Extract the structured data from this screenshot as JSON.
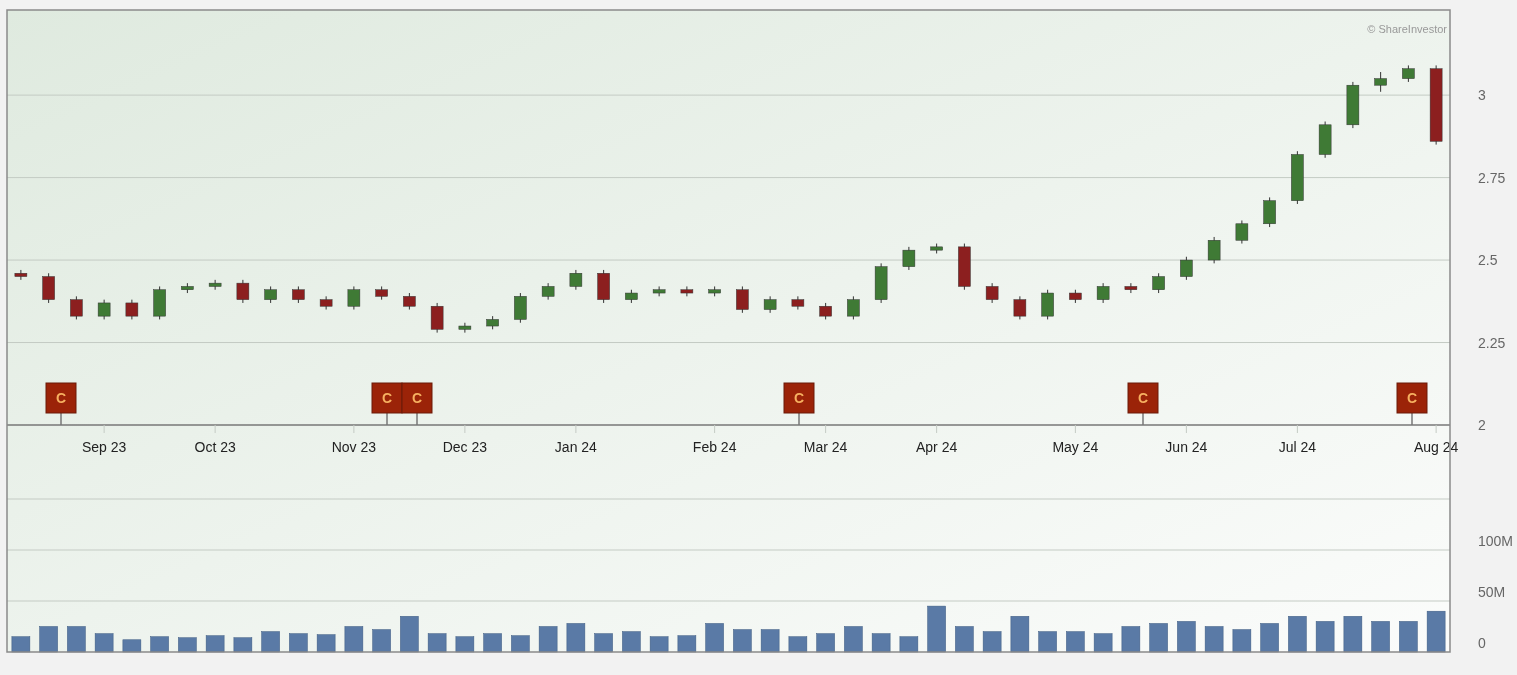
{
  "copyright": "© ShareInvestor",
  "price_chart": {
    "chart_data": {
      "type": "candlestick",
      "categories": [
        null,
        null,
        null,
        "Sep 23",
        null,
        null,
        null,
        "Oct 23",
        null,
        null,
        null,
        null,
        "Nov 23",
        null,
        null,
        null,
        "Dec 23",
        null,
        null,
        null,
        "Jan 24",
        null,
        null,
        null,
        null,
        "Feb 24",
        null,
        null,
        null,
        "Mar 24",
        null,
        null,
        null,
        "Apr 24",
        null,
        null,
        null,
        null,
        "May 24",
        null,
        null,
        null,
        "Jun 24",
        null,
        null,
        null,
        "Jul 24",
        null,
        null,
        null,
        null,
        "Aug 24"
      ],
      "ohlc": [
        [
          2.46,
          2.47,
          2.44,
          2.45
        ],
        [
          2.45,
          2.46,
          2.37,
          2.38
        ],
        [
          2.38,
          2.39,
          2.32,
          2.33
        ],
        [
          2.33,
          2.38,
          2.32,
          2.37
        ],
        [
          2.37,
          2.38,
          2.32,
          2.33
        ],
        [
          2.33,
          2.42,
          2.32,
          2.41
        ],
        [
          2.41,
          2.43,
          2.4,
          2.42
        ],
        [
          2.42,
          2.44,
          2.41,
          2.43
        ],
        [
          2.43,
          2.44,
          2.37,
          2.38
        ],
        [
          2.38,
          2.42,
          2.37,
          2.41
        ],
        [
          2.41,
          2.42,
          2.37,
          2.38
        ],
        [
          2.38,
          2.39,
          2.35,
          2.36
        ],
        [
          2.36,
          2.42,
          2.35,
          2.41
        ],
        [
          2.41,
          2.42,
          2.38,
          2.39
        ],
        [
          2.39,
          2.4,
          2.35,
          2.36
        ],
        [
          2.36,
          2.37,
          2.28,
          2.29
        ],
        [
          2.29,
          2.31,
          2.28,
          2.3
        ],
        [
          2.3,
          2.33,
          2.29,
          2.32
        ],
        [
          2.32,
          2.4,
          2.31,
          2.39
        ],
        [
          2.39,
          2.43,
          2.38,
          2.42
        ],
        [
          2.42,
          2.47,
          2.41,
          2.46
        ],
        [
          2.46,
          2.47,
          2.37,
          2.38
        ],
        [
          2.38,
          2.41,
          2.37,
          2.4
        ],
        [
          2.4,
          2.42,
          2.39,
          2.41
        ],
        [
          2.41,
          2.42,
          2.39,
          2.4
        ],
        [
          2.4,
          2.42,
          2.39,
          2.41
        ],
        [
          2.41,
          2.42,
          2.34,
          2.35
        ],
        [
          2.35,
          2.39,
          2.34,
          2.38
        ],
        [
          2.38,
          2.39,
          2.35,
          2.36
        ],
        [
          2.36,
          2.37,
          2.32,
          2.33
        ],
        [
          2.33,
          2.39,
          2.32,
          2.38
        ],
        [
          2.38,
          2.49,
          2.37,
          2.48
        ],
        [
          2.48,
          2.54,
          2.47,
          2.53
        ],
        [
          2.53,
          2.55,
          2.52,
          2.54
        ],
        [
          2.54,
          2.55,
          2.41,
          2.42
        ],
        [
          2.42,
          2.43,
          2.37,
          2.38
        ],
        [
          2.38,
          2.39,
          2.32,
          2.33
        ],
        [
          2.33,
          2.41,
          2.32,
          2.4
        ],
        [
          2.4,
          2.41,
          2.37,
          2.38
        ],
        [
          2.38,
          2.43,
          2.37,
          2.42
        ],
        [
          2.42,
          2.43,
          2.4,
          2.41
        ],
        [
          2.41,
          2.46,
          2.4,
          2.45
        ],
        [
          2.45,
          2.51,
          2.44,
          2.5
        ],
        [
          2.5,
          2.57,
          2.49,
          2.56
        ],
        [
          2.56,
          2.62,
          2.55,
          2.61
        ],
        [
          2.61,
          2.69,
          2.6,
          2.68
        ],
        [
          2.68,
          2.83,
          2.67,
          2.82
        ],
        [
          2.82,
          2.92,
          2.81,
          2.91
        ],
        [
          2.91,
          3.04,
          2.9,
          3.03
        ],
        [
          3.03,
          3.07,
          3.01,
          3.05
        ],
        [
          3.05,
          3.09,
          3.04,
          3.08
        ],
        [
          3.08,
          3.09,
          2.85,
          2.86
        ]
      ],
      "ylim": [
        2,
        3.258
      ],
      "grid": true,
      "yticks": [
        {
          "value": 2,
          "label": "2"
        },
        {
          "value": 2.25,
          "label": "2.25"
        },
        {
          "value": 2.5,
          "label": "2.5"
        },
        {
          "value": 2.75,
          "label": "2.75"
        },
        {
          "value": 3,
          "label": "3"
        }
      ]
    },
    "event_markers": [
      {
        "label": "C"
      },
      {
        "label": "C"
      },
      {
        "label": "C"
      },
      {
        "label": "C"
      },
      {
        "label": "C"
      },
      {
        "label": "C"
      }
    ]
  },
  "volume_chart": {
    "chart_data": {
      "type": "bar",
      "categories": [
        null,
        null,
        null,
        null,
        null,
        null,
        null,
        null,
        null,
        null,
        null,
        null,
        null,
        null,
        null,
        null,
        null,
        null,
        null,
        null,
        null,
        null,
        null,
        null,
        null,
        null,
        null,
        null,
        null,
        null,
        null,
        null,
        null,
        null,
        null,
        null,
        null,
        null,
        null,
        null,
        null,
        null,
        null,
        null,
        null,
        null,
        null,
        null,
        null,
        null,
        null,
        null
      ],
      "series": [
        {
          "color": "#5a7aa6",
          "values": [
            15,
            25,
            25,
            18,
            12,
            15,
            14,
            16,
            14,
            20,
            18,
            17,
            25,
            22,
            35,
            18,
            15,
            18,
            16,
            25,
            28,
            18,
            20,
            15,
            16,
            28,
            22,
            22,
            15,
            18,
            25,
            18,
            15,
            45,
            25,
            20,
            35,
            20,
            20,
            18,
            25,
            28,
            30,
            25,
            22,
            28,
            35,
            30,
            35,
            30,
            30,
            40
          ]
        }
      ],
      "ylim": [
        0,
        150
      ],
      "grid": true,
      "yticks": [
        {
          "value": 0,
          "label": "0"
        },
        {
          "value": 50,
          "label": "50M"
        },
        {
          "value": 100,
          "label": "100M"
        }
      ]
    }
  }
}
